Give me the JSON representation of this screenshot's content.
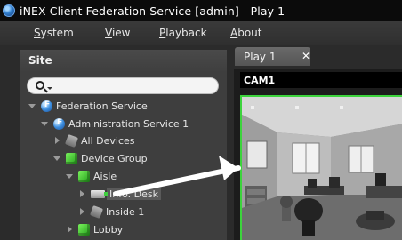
{
  "window": {
    "title": "iNEX Client Federation Service [admin] - Play  1",
    "icon": "app-globe-icon"
  },
  "menu": {
    "items": [
      {
        "key": "S",
        "rest": "ystem"
      },
      {
        "key": "V",
        "rest": "iew"
      },
      {
        "key": "P",
        "rest": "layback"
      },
      {
        "key": "A",
        "rest": "bout"
      }
    ]
  },
  "site_panel": {
    "title": "Site",
    "search": {
      "value": "",
      "placeholder": ""
    },
    "tree": [
      {
        "label": "Federation Service",
        "icon": "federation-icon",
        "expanded": true
      },
      {
        "label": "Administration Service 1",
        "icon": "federation-icon",
        "expanded": true
      },
      {
        "label": "All Devices",
        "icon": "device-icon",
        "expanded": false
      },
      {
        "label": "Device Group",
        "icon": "group-icon",
        "expanded": true
      },
      {
        "label": "Aisle",
        "icon": "group-icon",
        "expanded": true
      },
      {
        "label": "Info. Desk",
        "icon": "camera-icon",
        "expanded": false,
        "selected": true
      },
      {
        "label": "Inside 1",
        "icon": "device-icon",
        "expanded": false
      },
      {
        "label": "Lobby",
        "icon": "group-icon",
        "expanded": false
      }
    ]
  },
  "tabs": [
    {
      "label": "Play  1",
      "close": "✕"
    }
  ],
  "viewer": {
    "camera_label": "CAM1",
    "active_border_color": "#3cd43c"
  },
  "colors": {
    "titlebar": "#0b0b0b",
    "panel": "#3e3e3e",
    "background": "#2b2b2b",
    "selection": "#5a5a5a"
  }
}
